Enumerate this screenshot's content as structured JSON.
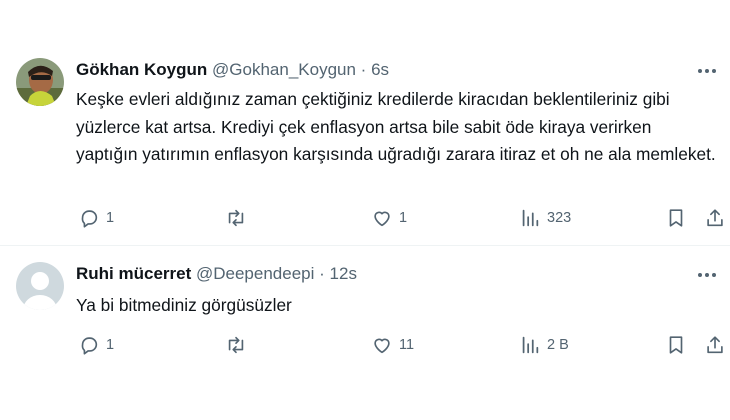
{
  "tweets": [
    {
      "name": "Gökhan Koygun",
      "handle": "@Gokhan_Koygun",
      "separator": "·",
      "time": "6s",
      "text": "Keşke evleri aldığınız zaman çektiğiniz kredilerde kiracıdan beklentileriniz gibi yüzlerce kat artsa. Krediyi çek enflasyon artsa bile sabit öde kiraya verirken yaptığın yatırımın enflasyon karşısında uğradığı zarara itiraz et oh ne ala memleket.",
      "replies": "1",
      "retweets": "",
      "likes": "1",
      "views": "323"
    },
    {
      "name": "Ruhi mücerret",
      "handle": "@Deependeepi",
      "separator": "·",
      "time": "12s",
      "text": "Ya bi bitmediniz görgüsüzler",
      "replies": "1",
      "retweets": "",
      "likes": "11",
      "views": "2 B"
    }
  ],
  "colors": {
    "text": "#0f1419",
    "secondary": "#536471",
    "divider": "#eff3f4",
    "default_avatar": "#cfd9de"
  },
  "icons": [
    "reply-icon",
    "retweet-icon",
    "like-icon",
    "views-icon",
    "bookmark-icon",
    "share-icon",
    "more-icon"
  ]
}
